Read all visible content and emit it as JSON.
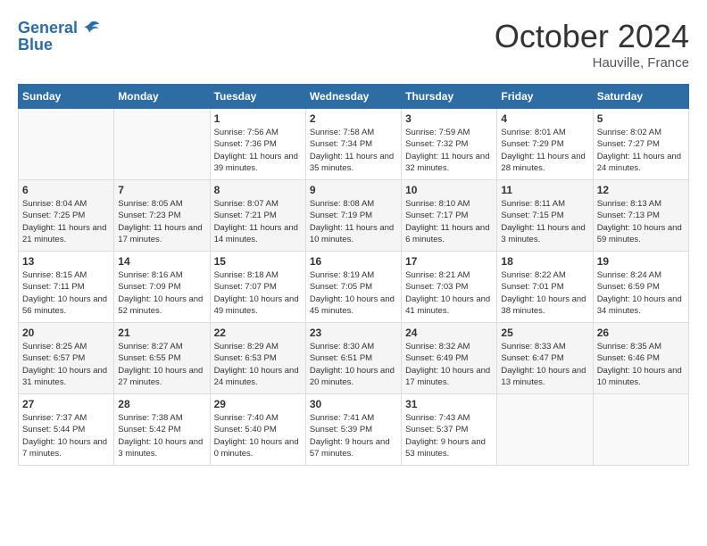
{
  "header": {
    "logo_line1": "General",
    "logo_line2": "Blue",
    "month": "October 2024",
    "location": "Hauville, France"
  },
  "weekdays": [
    "Sunday",
    "Monday",
    "Tuesday",
    "Wednesday",
    "Thursday",
    "Friday",
    "Saturday"
  ],
  "weeks": [
    [
      {
        "day": "",
        "sunrise": "",
        "sunset": "",
        "daylight": ""
      },
      {
        "day": "",
        "sunrise": "",
        "sunset": "",
        "daylight": ""
      },
      {
        "day": "1",
        "sunrise": "Sunrise: 7:56 AM",
        "sunset": "Sunset: 7:36 PM",
        "daylight": "Daylight: 11 hours and 39 minutes."
      },
      {
        "day": "2",
        "sunrise": "Sunrise: 7:58 AM",
        "sunset": "Sunset: 7:34 PM",
        "daylight": "Daylight: 11 hours and 35 minutes."
      },
      {
        "day": "3",
        "sunrise": "Sunrise: 7:59 AM",
        "sunset": "Sunset: 7:32 PM",
        "daylight": "Daylight: 11 hours and 32 minutes."
      },
      {
        "day": "4",
        "sunrise": "Sunrise: 8:01 AM",
        "sunset": "Sunset: 7:29 PM",
        "daylight": "Daylight: 11 hours and 28 minutes."
      },
      {
        "day": "5",
        "sunrise": "Sunrise: 8:02 AM",
        "sunset": "Sunset: 7:27 PM",
        "daylight": "Daylight: 11 hours and 24 minutes."
      }
    ],
    [
      {
        "day": "6",
        "sunrise": "Sunrise: 8:04 AM",
        "sunset": "Sunset: 7:25 PM",
        "daylight": "Daylight: 11 hours and 21 minutes."
      },
      {
        "day": "7",
        "sunrise": "Sunrise: 8:05 AM",
        "sunset": "Sunset: 7:23 PM",
        "daylight": "Daylight: 11 hours and 17 minutes."
      },
      {
        "day": "8",
        "sunrise": "Sunrise: 8:07 AM",
        "sunset": "Sunset: 7:21 PM",
        "daylight": "Daylight: 11 hours and 14 minutes."
      },
      {
        "day": "9",
        "sunrise": "Sunrise: 8:08 AM",
        "sunset": "Sunset: 7:19 PM",
        "daylight": "Daylight: 11 hours and 10 minutes."
      },
      {
        "day": "10",
        "sunrise": "Sunrise: 8:10 AM",
        "sunset": "Sunset: 7:17 PM",
        "daylight": "Daylight: 11 hours and 6 minutes."
      },
      {
        "day": "11",
        "sunrise": "Sunrise: 8:11 AM",
        "sunset": "Sunset: 7:15 PM",
        "daylight": "Daylight: 11 hours and 3 minutes."
      },
      {
        "day": "12",
        "sunrise": "Sunrise: 8:13 AM",
        "sunset": "Sunset: 7:13 PM",
        "daylight": "Daylight: 10 hours and 59 minutes."
      }
    ],
    [
      {
        "day": "13",
        "sunrise": "Sunrise: 8:15 AM",
        "sunset": "Sunset: 7:11 PM",
        "daylight": "Daylight: 10 hours and 56 minutes."
      },
      {
        "day": "14",
        "sunrise": "Sunrise: 8:16 AM",
        "sunset": "Sunset: 7:09 PM",
        "daylight": "Daylight: 10 hours and 52 minutes."
      },
      {
        "day": "15",
        "sunrise": "Sunrise: 8:18 AM",
        "sunset": "Sunset: 7:07 PM",
        "daylight": "Daylight: 10 hours and 49 minutes."
      },
      {
        "day": "16",
        "sunrise": "Sunrise: 8:19 AM",
        "sunset": "Sunset: 7:05 PM",
        "daylight": "Daylight: 10 hours and 45 minutes."
      },
      {
        "day": "17",
        "sunrise": "Sunrise: 8:21 AM",
        "sunset": "Sunset: 7:03 PM",
        "daylight": "Daylight: 10 hours and 41 minutes."
      },
      {
        "day": "18",
        "sunrise": "Sunrise: 8:22 AM",
        "sunset": "Sunset: 7:01 PM",
        "daylight": "Daylight: 10 hours and 38 minutes."
      },
      {
        "day": "19",
        "sunrise": "Sunrise: 8:24 AM",
        "sunset": "Sunset: 6:59 PM",
        "daylight": "Daylight: 10 hours and 34 minutes."
      }
    ],
    [
      {
        "day": "20",
        "sunrise": "Sunrise: 8:25 AM",
        "sunset": "Sunset: 6:57 PM",
        "daylight": "Daylight: 10 hours and 31 minutes."
      },
      {
        "day": "21",
        "sunrise": "Sunrise: 8:27 AM",
        "sunset": "Sunset: 6:55 PM",
        "daylight": "Daylight: 10 hours and 27 minutes."
      },
      {
        "day": "22",
        "sunrise": "Sunrise: 8:29 AM",
        "sunset": "Sunset: 6:53 PM",
        "daylight": "Daylight: 10 hours and 24 minutes."
      },
      {
        "day": "23",
        "sunrise": "Sunrise: 8:30 AM",
        "sunset": "Sunset: 6:51 PM",
        "daylight": "Daylight: 10 hours and 20 minutes."
      },
      {
        "day": "24",
        "sunrise": "Sunrise: 8:32 AM",
        "sunset": "Sunset: 6:49 PM",
        "daylight": "Daylight: 10 hours and 17 minutes."
      },
      {
        "day": "25",
        "sunrise": "Sunrise: 8:33 AM",
        "sunset": "Sunset: 6:47 PM",
        "daylight": "Daylight: 10 hours and 13 minutes."
      },
      {
        "day": "26",
        "sunrise": "Sunrise: 8:35 AM",
        "sunset": "Sunset: 6:46 PM",
        "daylight": "Daylight: 10 hours and 10 minutes."
      }
    ],
    [
      {
        "day": "27",
        "sunrise": "Sunrise: 7:37 AM",
        "sunset": "Sunset: 5:44 PM",
        "daylight": "Daylight: 10 hours and 7 minutes."
      },
      {
        "day": "28",
        "sunrise": "Sunrise: 7:38 AM",
        "sunset": "Sunset: 5:42 PM",
        "daylight": "Daylight: 10 hours and 3 minutes."
      },
      {
        "day": "29",
        "sunrise": "Sunrise: 7:40 AM",
        "sunset": "Sunset: 5:40 PM",
        "daylight": "Daylight: 10 hours and 0 minutes."
      },
      {
        "day": "30",
        "sunrise": "Sunrise: 7:41 AM",
        "sunset": "Sunset: 5:39 PM",
        "daylight": "Daylight: 9 hours and 57 minutes."
      },
      {
        "day": "31",
        "sunrise": "Sunrise: 7:43 AM",
        "sunset": "Sunset: 5:37 PM",
        "daylight": "Daylight: 9 hours and 53 minutes."
      },
      {
        "day": "",
        "sunrise": "",
        "sunset": "",
        "daylight": ""
      },
      {
        "day": "",
        "sunrise": "",
        "sunset": "",
        "daylight": ""
      }
    ]
  ]
}
